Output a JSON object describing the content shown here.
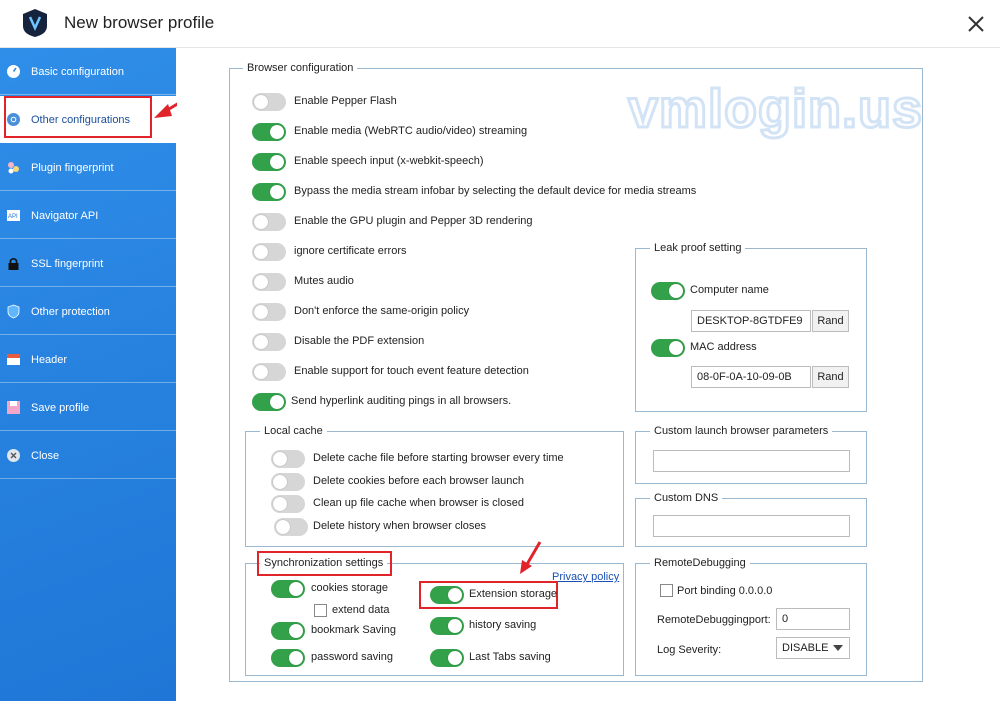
{
  "window": {
    "title": "New browser profile"
  },
  "sidebar": {
    "items": [
      {
        "label": "Basic configuration",
        "icon": "gauge-icon"
      },
      {
        "label": "Other configurations",
        "icon": "chrome-icon"
      },
      {
        "label": "Plugin fingerprint",
        "icon": "puzzle-icon"
      },
      {
        "label": "Navigator API",
        "icon": "api-icon"
      },
      {
        "label": "SSL fingerprint",
        "icon": "lock-icon"
      },
      {
        "label": "Other protection",
        "icon": "shield-icon"
      },
      {
        "label": "Header",
        "icon": "header-icon"
      },
      {
        "label": "Save profile",
        "icon": "save-icon"
      },
      {
        "label": "Close",
        "icon": "close-circle-icon"
      }
    ]
  },
  "watermark": "vmlogin.us",
  "browser_config": {
    "legend": "Browser configuration",
    "options": [
      {
        "label": "Enable Pepper Flash",
        "on": false
      },
      {
        "label": "Enable media (WebRTC audio/video) streaming",
        "on": true
      },
      {
        "label": "Enable speech input (x-webkit-speech)",
        "on": true
      },
      {
        "label": "Bypass the media stream infobar by selecting the default device for media streams",
        "on": true
      },
      {
        "label": "Enable the GPU plugin and Pepper 3D rendering",
        "on": false
      },
      {
        "label": "ignore certificate errors",
        "on": false
      },
      {
        "label": "Mutes audio",
        "on": false
      },
      {
        "label": "Don't enforce the same-origin policy",
        "on": false
      },
      {
        "label": "Disable the PDF extension",
        "on": false
      },
      {
        "label": "Enable support for touch event feature detection",
        "on": false
      },
      {
        "label": "Send hyperlink auditing pings in all browsers.",
        "on": true
      }
    ]
  },
  "leak_proof": {
    "legend": "Leak proof setting",
    "computer_name_label": "Computer name",
    "computer_name_on": true,
    "computer_name_value": "DESKTOP-8GTDFE9",
    "mac_label": "MAC address",
    "mac_on": true,
    "mac_value": "08-0F-0A-10-09-0B",
    "rand_label": "Rand"
  },
  "local_cache": {
    "legend": "Local cache",
    "options": [
      {
        "label": "Delete cache file before starting browser every time",
        "on": false
      },
      {
        "label": "Delete cookies before each browser launch",
        "on": false
      },
      {
        "label": "Clean up file cache when browser is closed",
        "on": false
      },
      {
        "label": "Delete history when browser closes",
        "on": false
      }
    ]
  },
  "custom_launch": {
    "legend": "Custom launch browser parameters",
    "value": ""
  },
  "custom_dns": {
    "legend": "Custom DNS",
    "value": ""
  },
  "sync": {
    "legend": "Synchronization settings",
    "privacy_link": "Privacy policy",
    "cookies_label": "cookies storage",
    "extend_label": "extend data",
    "bookmark_label": "bookmark Saving",
    "password_label": "password saving",
    "extension_label": "Extension storage",
    "history_label": "history saving",
    "lasttabs_label": "Last Tabs saving"
  },
  "remote_debug": {
    "legend": "RemoteDebugging",
    "port_binding_label": "Port binding 0.0.0.0",
    "port_label": "RemoteDebuggingport:",
    "port_value": "0",
    "severity_label": "Log Severity:",
    "severity_value": "DISABLE"
  },
  "colors": {
    "sidebar": "#2f8ee8",
    "toggle_on": "#33a14a",
    "highlight": "#e0242a"
  }
}
